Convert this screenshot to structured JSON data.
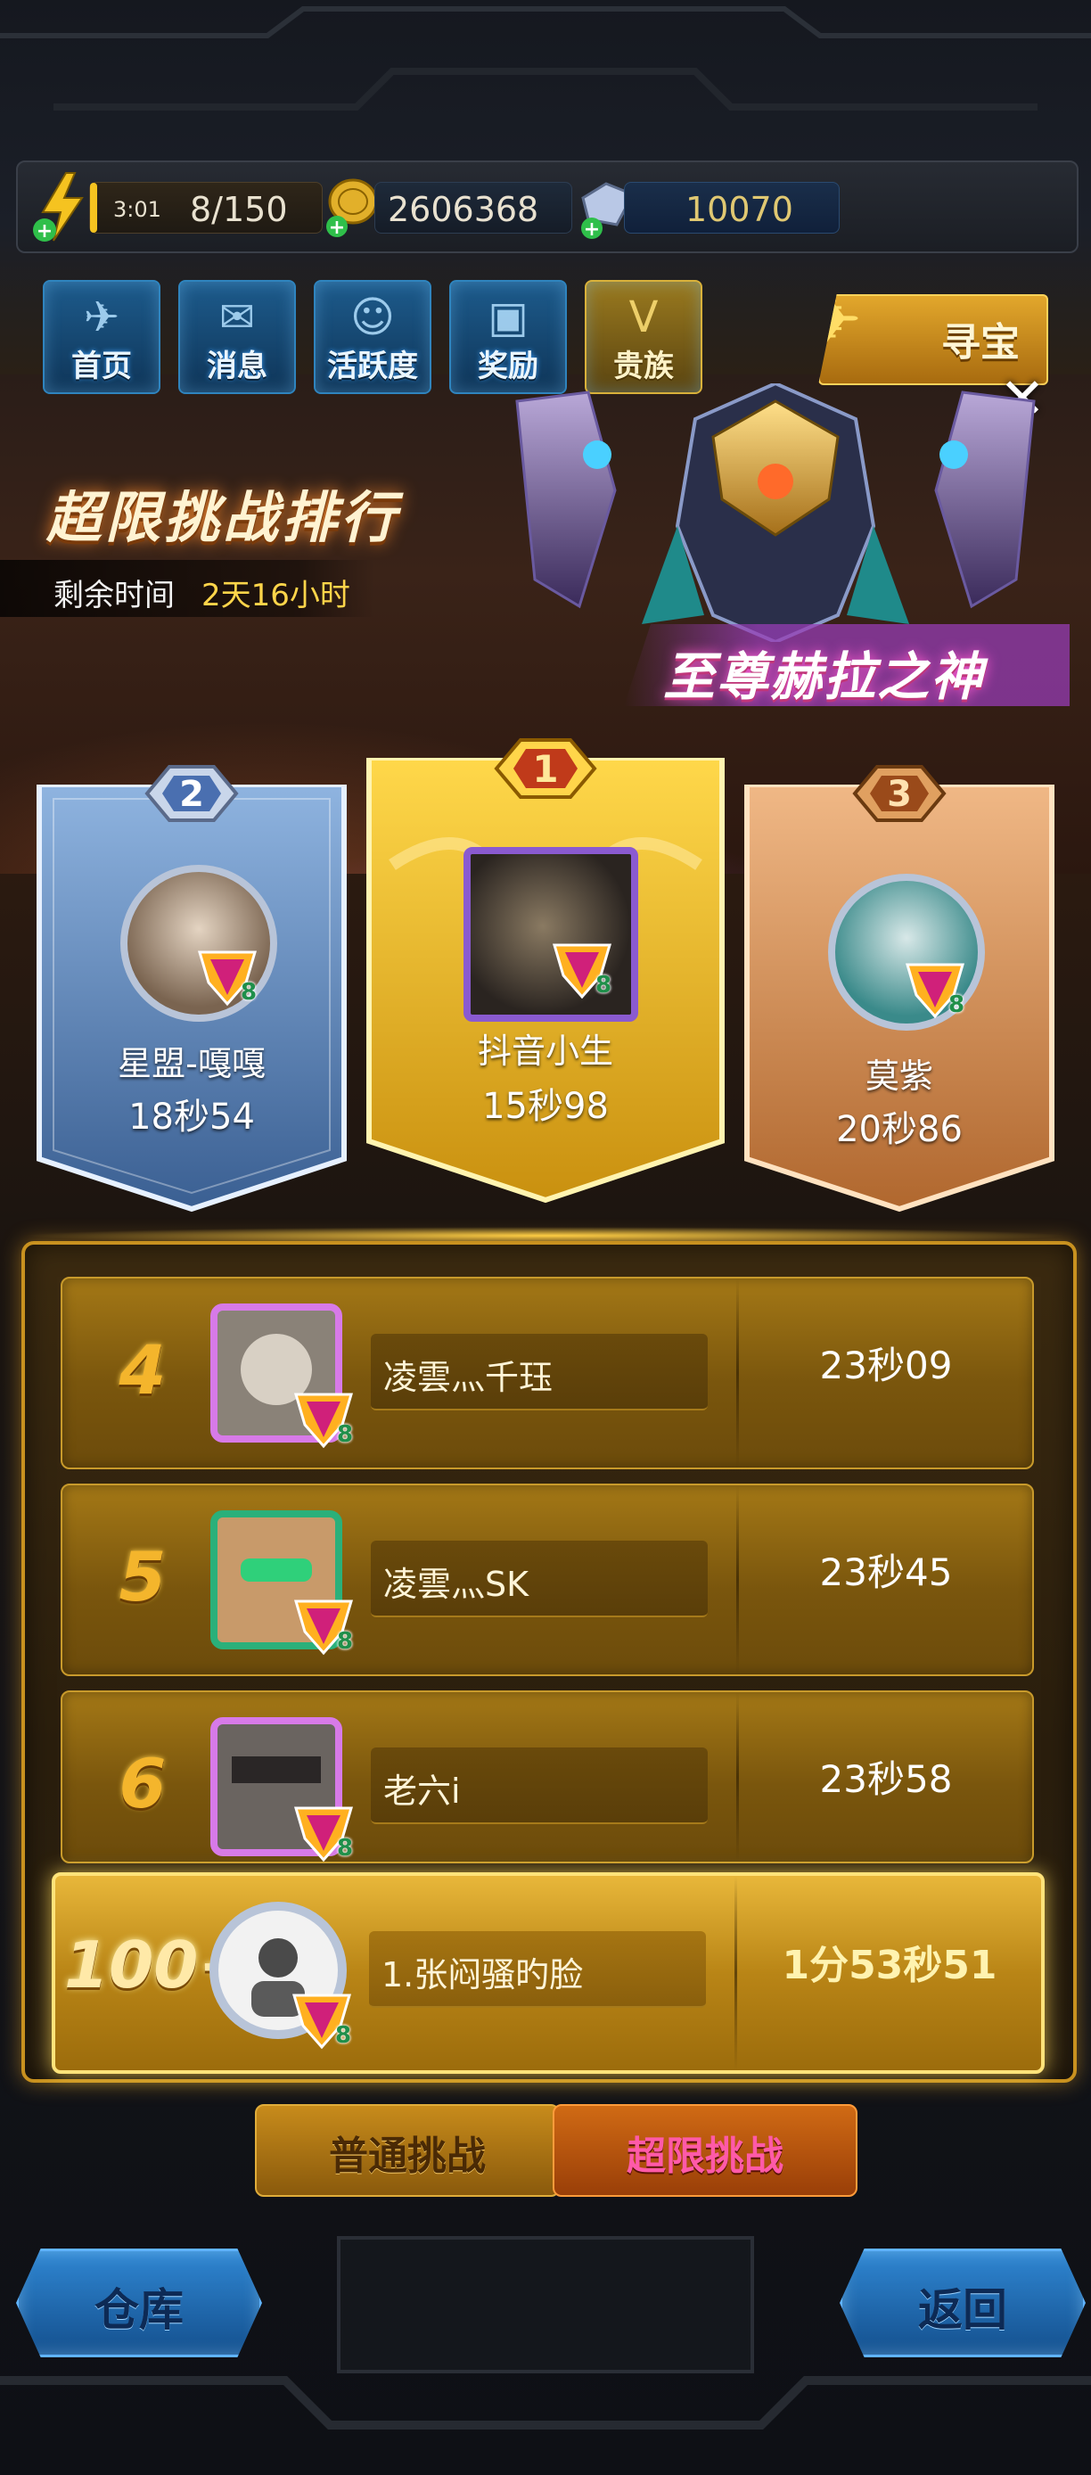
{
  "resources": {
    "energy_timer": "3:01",
    "energy": "8/150",
    "gold": "2606368",
    "crystals": "10070"
  },
  "nav": {
    "tabs": [
      {
        "label": "首页",
        "icon": "plane-icon"
      },
      {
        "label": "消息",
        "icon": "mail-icon"
      },
      {
        "label": "活跃度",
        "icon": "smile-icon"
      },
      {
        "label": "奖励",
        "icon": "gift-icon"
      },
      {
        "label": "贵族",
        "icon": "vip-icon"
      }
    ],
    "treasure_label": "寻宝"
  },
  "event": {
    "title": "超限挑战排行",
    "time_label": "剩余时间",
    "time_value": "2天16小时",
    "reward_name": "至尊赫拉之神"
  },
  "podium": [
    {
      "rank": "1",
      "name": "抖音小生",
      "time": "15秒98",
      "vip": "8"
    },
    {
      "rank": "2",
      "name": "星盟-嘎嘎",
      "time": "18秒54",
      "vip": "8"
    },
    {
      "rank": "3",
      "name": "莫紫",
      "time": "20秒86",
      "vip": "8"
    }
  ],
  "rankings": [
    {
      "rank": "4",
      "name": "凌雲灬千珏",
      "time": "23秒09",
      "vip": "8"
    },
    {
      "rank": "5",
      "name": "凌雲灬SK",
      "time": "23秒45",
      "vip": "8"
    },
    {
      "rank": "6",
      "name": "老六i",
      "time": "23秒58",
      "vip": "8"
    }
  ],
  "my_rank": {
    "rank": "100+",
    "name": "1.张闷骚旳脸",
    "time": "1分53秒51",
    "vip": "8"
  },
  "challenge_tabs": {
    "normal": "普通挑战",
    "extreme": "超限挑战"
  },
  "bottom_buttons": {
    "warehouse": "仓库",
    "back": "返回"
  },
  "colors": {
    "gold": "#ffd54a",
    "accent_blue": "#2f86d2",
    "panel_border": "#c8911f"
  }
}
